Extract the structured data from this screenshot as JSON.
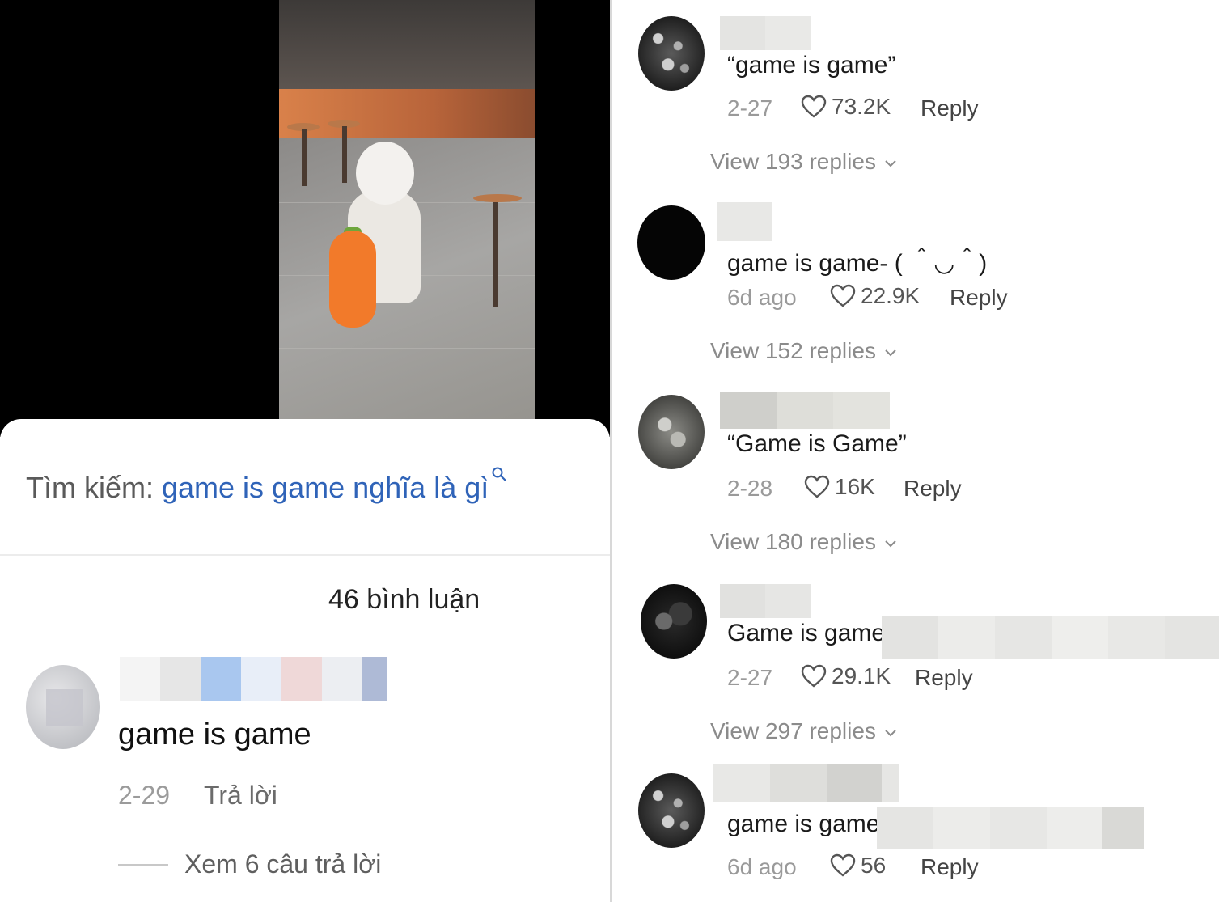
{
  "left": {
    "search": {
      "prefix": "Tìm kiếm: ",
      "query": "game is game nghĩa là gì"
    },
    "comment_count": "46 bình luận",
    "comment": {
      "text": "game is game",
      "date": "2-29",
      "reply_label": "Trả lời",
      "view_replies": "Xem 6 câu trả lời"
    }
  },
  "right": {
    "comments": [
      {
        "text": "“game is game”",
        "date": "2-27",
        "likes": "73.2K",
        "reply": "Reply",
        "view": "View 193 replies"
      },
      {
        "text": "game is game- ( ＾◡＾)",
        "date": "6d ago",
        "likes": "22.9K",
        "reply": "Reply",
        "view": "View 152 replies"
      },
      {
        "text": "“Game is Game”",
        "date": "2-28",
        "likes": "16K",
        "reply": "Reply",
        "view": "View 180 replies"
      },
      {
        "text": "Game is game",
        "date": "2-27",
        "likes": "29.1K",
        "reply": "Reply",
        "view": "View 297 replies"
      },
      {
        "text": "game is game",
        "date": "6d ago",
        "likes": "56",
        "reply": "Reply"
      }
    ]
  },
  "colors": {
    "link_blue": "#2f63b8",
    "meta_gray": "#9a9a9a",
    "redaction_gray": "#e2e2e0"
  },
  "icons": [
    "search-icon",
    "heart-icon",
    "chevron-down-icon"
  ]
}
